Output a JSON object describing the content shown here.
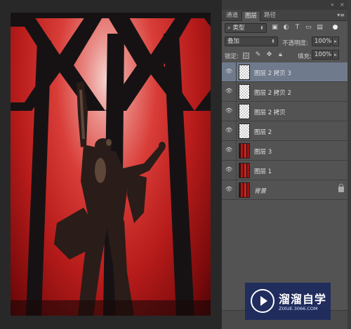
{
  "panel": {
    "tabs": [
      {
        "label": "通道",
        "active": false
      },
      {
        "label": "图层",
        "active": true
      },
      {
        "label": "路径",
        "active": false
      }
    ],
    "filter": {
      "label": "类型"
    },
    "blend_mode": "叠加",
    "opacity_label": "不透明度:",
    "opacity_value": "100%",
    "lock_label": "锁定:",
    "fill_label": "填充:",
    "fill_value": "100%",
    "layers": [
      {
        "name": "图层 2 拷贝 3",
        "thumb": "transparent",
        "selected": true,
        "italic": false,
        "locked": false
      },
      {
        "name": "图层 2 拷贝 2",
        "thumb": "transparent",
        "selected": false,
        "italic": false,
        "locked": false
      },
      {
        "name": "图层 2 拷贝",
        "thumb": "transparent",
        "selected": false,
        "italic": false,
        "locked": false
      },
      {
        "name": "图层 2",
        "thumb": "transparent",
        "selected": false,
        "italic": false,
        "locked": false
      },
      {
        "name": "图层 3",
        "thumb": "photo",
        "selected": false,
        "italic": false,
        "locked": false
      },
      {
        "name": "图层 1",
        "thumb": "photo",
        "selected": false,
        "italic": false,
        "locked": false
      },
      {
        "name": "背景",
        "thumb": "photo",
        "selected": false,
        "italic": true,
        "locked": true
      }
    ]
  },
  "watermark": {
    "title": "溜溜自学",
    "url": "ZIXUE.3066.COM"
  },
  "colors": {
    "panel_bg": "#535353",
    "selected_layer": "#6f7a8c",
    "canvas_bg": "#282828",
    "photo_red": "#c8201f"
  }
}
